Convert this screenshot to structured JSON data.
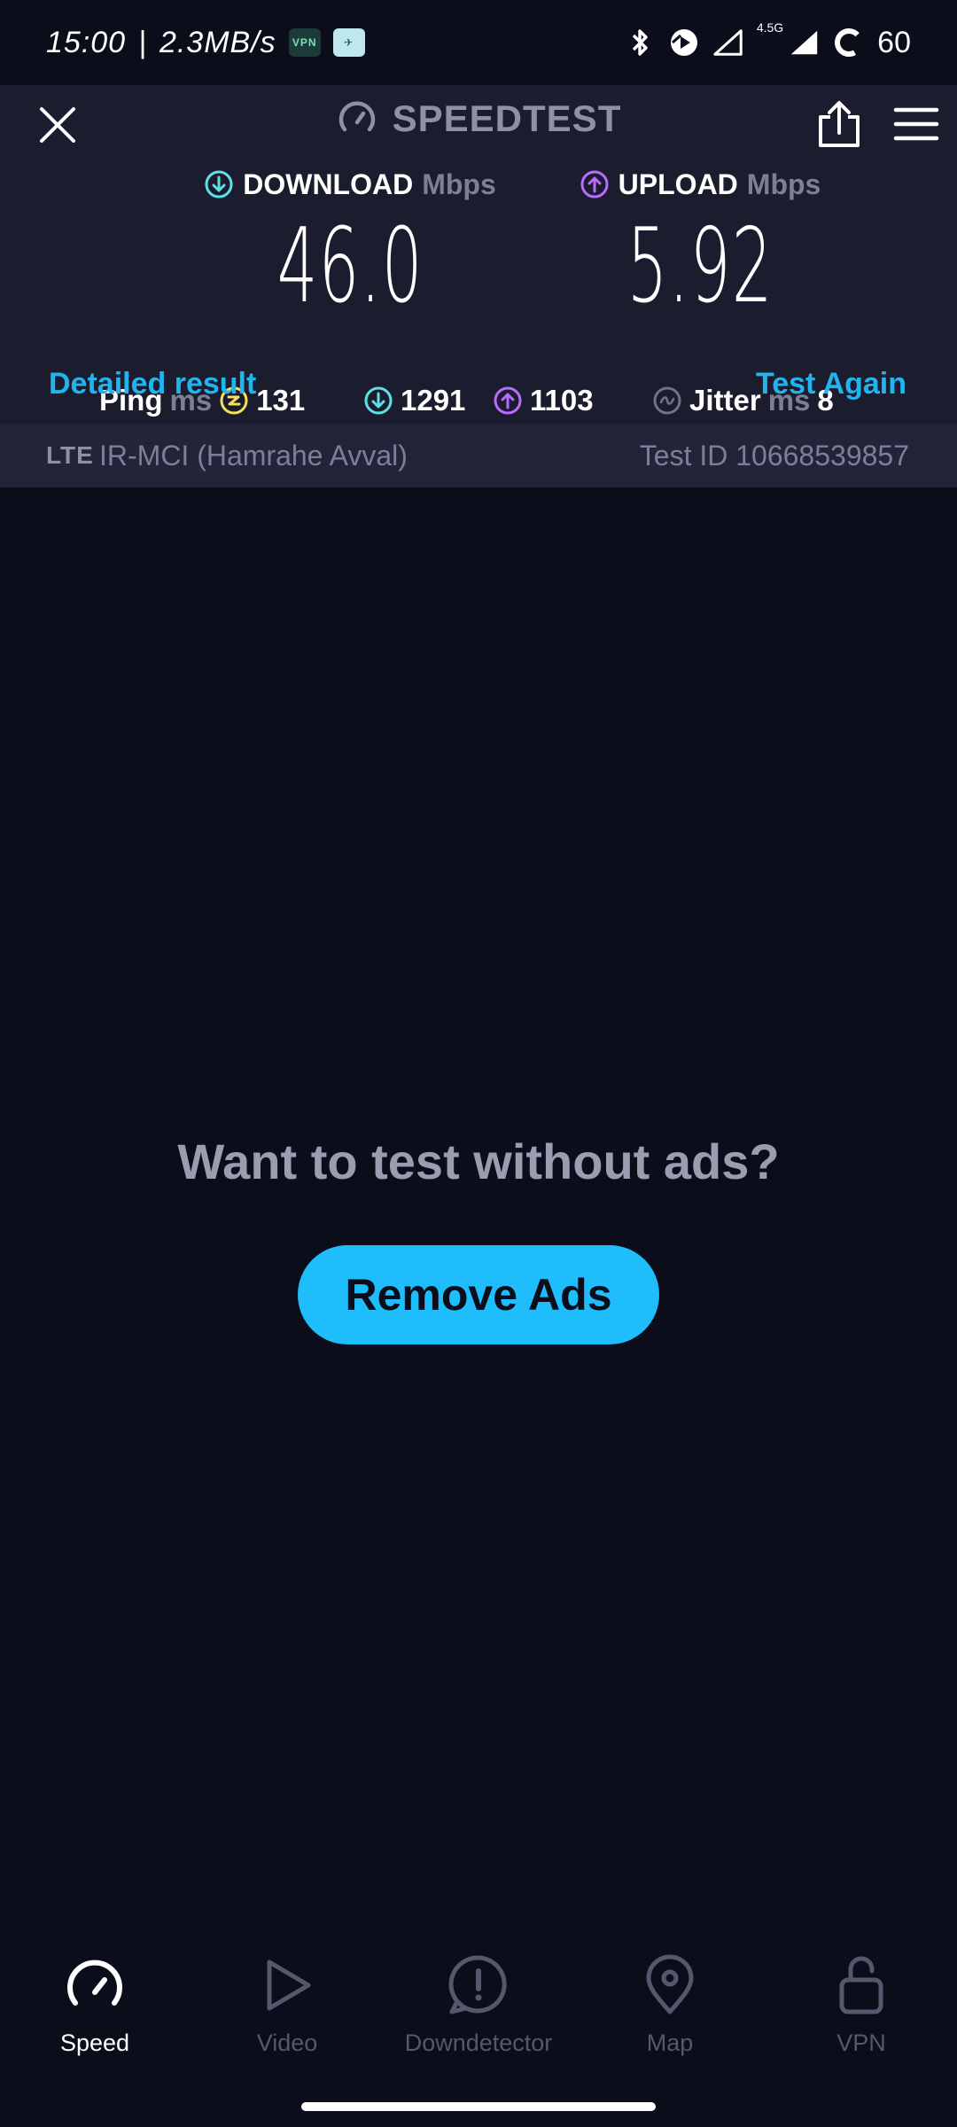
{
  "status_bar": {
    "time": "15:00",
    "separator": "|",
    "net_speed": "2.3MB/s",
    "app_icon_1": "VPN",
    "app_icon_2": "✈",
    "network_type": "4.5G",
    "battery": "60",
    "icons": [
      "bluetooth-icon",
      "media-icon",
      "signal-empty-icon",
      "signal-full-icon",
      "battery-ring-icon"
    ]
  },
  "header": {
    "title": "SPEEDTEST",
    "close_icon": "close-icon",
    "share_icon": "share-icon",
    "menu_icon": "hamburger-icon"
  },
  "results": {
    "download": {
      "label": "DOWNLOAD",
      "unit": "Mbps",
      "value": "46.0",
      "color": "#5ce1e6"
    },
    "upload": {
      "label": "UPLOAD",
      "unit": "Mbps",
      "value": "5.92",
      "color": "#b86cff"
    },
    "ping": {
      "label": "Ping",
      "unit": "ms",
      "value": "131",
      "color": "#f4e05a"
    },
    "download_latency": "1291",
    "upload_latency": "1103",
    "jitter": {
      "label": "Jitter",
      "unit": "ms",
      "value": "8"
    }
  },
  "links": {
    "detailed": "Detailed result",
    "again": "Test Again"
  },
  "connection": {
    "type": "LTE",
    "carrier": "IR-MCI (Hamrahe Avval)",
    "test_id": "Test ID 10668539857"
  },
  "promo": {
    "title": "Want to test without ads?",
    "button": "Remove Ads",
    "accent": "#1fbdfb"
  },
  "nav": {
    "items": [
      {
        "label": "Speed",
        "icon": "speedometer-icon",
        "active": true
      },
      {
        "label": "Video",
        "icon": "play-icon",
        "active": false
      },
      {
        "label": "Downdetector",
        "icon": "alert-icon",
        "active": false
      },
      {
        "label": "Map",
        "icon": "map-pin-icon",
        "active": false
      },
      {
        "label": "VPN",
        "icon": "unlock-icon",
        "active": false
      }
    ]
  }
}
